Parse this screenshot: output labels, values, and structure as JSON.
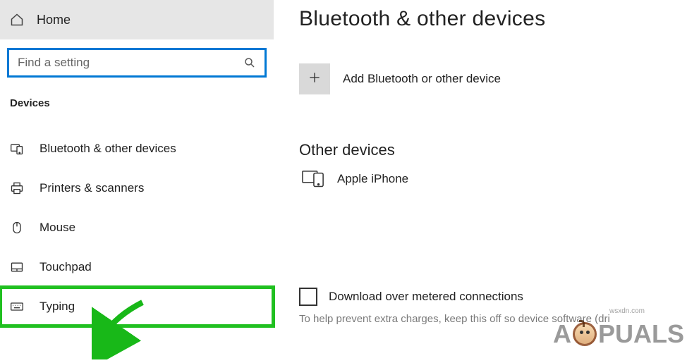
{
  "sidebar": {
    "home_label": "Home",
    "search_placeholder": "Find a setting",
    "category": "Devices",
    "items": [
      {
        "label": "Bluetooth & other devices"
      },
      {
        "label": "Printers & scanners"
      },
      {
        "label": "Mouse"
      },
      {
        "label": "Touchpad"
      },
      {
        "label": "Typing"
      }
    ]
  },
  "main": {
    "title": "Bluetooth & other devices",
    "add_device_label": "Add Bluetooth or other device",
    "other_devices_title": "Other devices",
    "devices": [
      {
        "label": "Apple iPhone"
      }
    ],
    "metered_label": "Download over metered connections",
    "help_text": "To help prevent extra charges, keep this off so device software (dri"
  },
  "watermark": {
    "text_left": "A",
    "text_right": "PUALS",
    "src": "wsxdn.com"
  }
}
